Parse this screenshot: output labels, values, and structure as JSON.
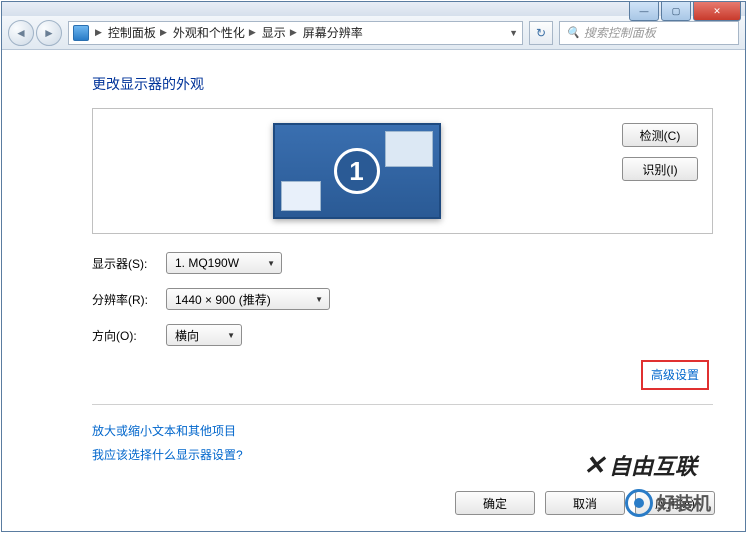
{
  "window": {
    "minimize": "—",
    "maximize": "▢",
    "close": "✕"
  },
  "toolbar": {
    "back": "◄",
    "forward": "►",
    "breadcrumbs": [
      "控制面板",
      "外观和个性化",
      "显示",
      "屏幕分辨率"
    ],
    "refresh": "↻",
    "search_placeholder": "搜索控制面板"
  },
  "page": {
    "title": "更改显示器的外观",
    "monitor_number": "1",
    "detect_btn": "检测(C)",
    "identify_btn": "识别(I)",
    "fields": {
      "display_label": "显示器(S):",
      "display_value": "1. MQ190W",
      "resolution_label": "分辨率(R):",
      "resolution_value": "1440 × 900 (推荐)",
      "orientation_label": "方向(O):",
      "orientation_value": "横向"
    },
    "advanced_link": "高级设置",
    "help_links": {
      "text_size": "放大或缩小文本和其他项目",
      "which_settings": "我应该选择什么显示器设置?"
    },
    "buttons": {
      "ok": "确定",
      "cancel": "取消",
      "apply": "应用(A)"
    }
  },
  "watermarks": {
    "w1": "自由互联",
    "w2": "好装机"
  }
}
